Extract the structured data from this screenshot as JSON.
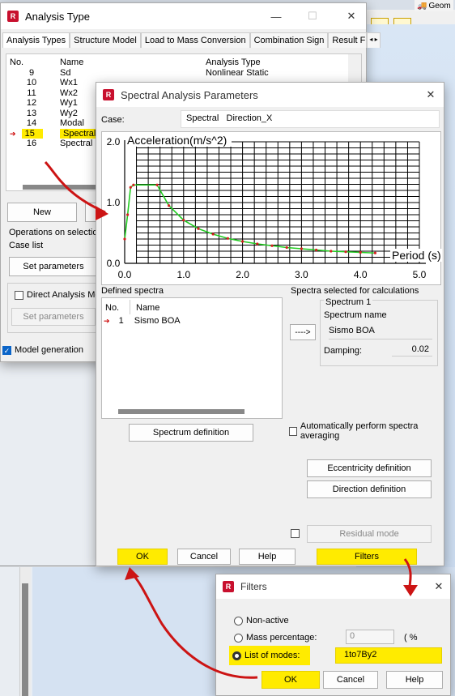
{
  "app": {
    "top_right_label": "Geom"
  },
  "analysis_window": {
    "title": "Analysis Type",
    "tabs": [
      "Analysis Types",
      "Structure Model",
      "Load to Mass Conversion",
      "Combination Sign",
      "Result Fi"
    ],
    "columns": [
      "No.",
      "Name",
      "Analysis Type"
    ],
    "rows": [
      {
        "no": "9",
        "name": "Sd",
        "type": "Nonlinear Static"
      },
      {
        "no": "10",
        "name": "Wx1",
        "type": ""
      },
      {
        "no": "11",
        "name": "Wx2",
        "type": ""
      },
      {
        "no": "12",
        "name": "Wy1",
        "type": ""
      },
      {
        "no": "13",
        "name": "Wy2",
        "type": ""
      },
      {
        "no": "14",
        "name": "Modal",
        "type": ""
      },
      {
        "no": "15",
        "name": "Spectral",
        "type": ""
      },
      {
        "no": "16",
        "name": "Spectral",
        "type": ""
      }
    ],
    "new_button": "New",
    "operations_label": "Operations on selectio",
    "case_list_label": "Case list",
    "set_parameters_button": "Set parameters",
    "direct_analysis_label": "Direct Analysis Met",
    "set_parameters_disabled": "Set parameters",
    "model_generation_label": "Model generation"
  },
  "spectral_dialog": {
    "title": "Spectral Analysis Parameters",
    "case_label": "Case:",
    "case_value": "Spectral   Direction_X",
    "defined_spectra_label": "Defined spectra",
    "spectra_columns": [
      "No.",
      "Name"
    ],
    "spectra_rows": [
      {
        "no": "1",
        "name": "Sismo BOA"
      }
    ],
    "selected_label": "Spectra selected for calculations",
    "spectrum_group": "Spectrum 1",
    "spectrum_name_label": "Spectrum name",
    "spectrum_name_value": "Sismo BOA",
    "damping_label": "Damping:",
    "damping_value": "0.02",
    "arrow_button": "---->",
    "spectrum_definition_button": "Spectrum definition",
    "auto_averaging_label": "Automatically perform spectra averaging",
    "eccentricity_button": "Eccentricity definition",
    "direction_button": "Direction definition",
    "residual_mode_button": "Residual mode",
    "ok_button": "OK",
    "cancel_button": "Cancel",
    "help_button": "Help",
    "filters_button": "Filters"
  },
  "chart_data": {
    "type": "line",
    "ylabel": "Acceleration(m/s^2)",
    "xlabel": "Period (s)",
    "xlim": [
      0.0,
      5.0
    ],
    "ylim": [
      0.0,
      2.0
    ],
    "x_ticks": [
      "0.0",
      "1.0",
      "2.0",
      "3.0",
      "4.0",
      "5.0"
    ],
    "y_ticks": [
      "0.0",
      "1.0",
      "2.0"
    ],
    "series": [
      {
        "x": [
          0.0,
          0.05,
          0.1,
          0.15,
          0.55,
          0.75,
          1.0,
          1.25,
          1.5,
          1.75,
          2.0,
          2.25,
          2.5,
          2.75,
          3.0,
          3.25,
          3.5,
          3.75,
          4.0,
          4.25
        ],
        "y": [
          0.4,
          0.8,
          1.25,
          1.29,
          1.29,
          0.95,
          0.71,
          0.57,
          0.48,
          0.41,
          0.36,
          0.32,
          0.29,
          0.26,
          0.24,
          0.22,
          0.2,
          0.19,
          0.18,
          0.17
        ]
      }
    ],
    "colors": {
      "line": "#22cc22",
      "points": "#d62020"
    }
  },
  "filters_dialog": {
    "title": "Filters",
    "non_active_label": "Non-active",
    "mass_percentage_label": "Mass percentage:",
    "mass_percentage_value": "0",
    "mass_unit": "( %",
    "list_of_modes_label": "List of modes:",
    "list_of_modes_value": "1to7By2",
    "ok_button": "OK",
    "cancel_button": "Cancel",
    "help_button": "Help"
  }
}
